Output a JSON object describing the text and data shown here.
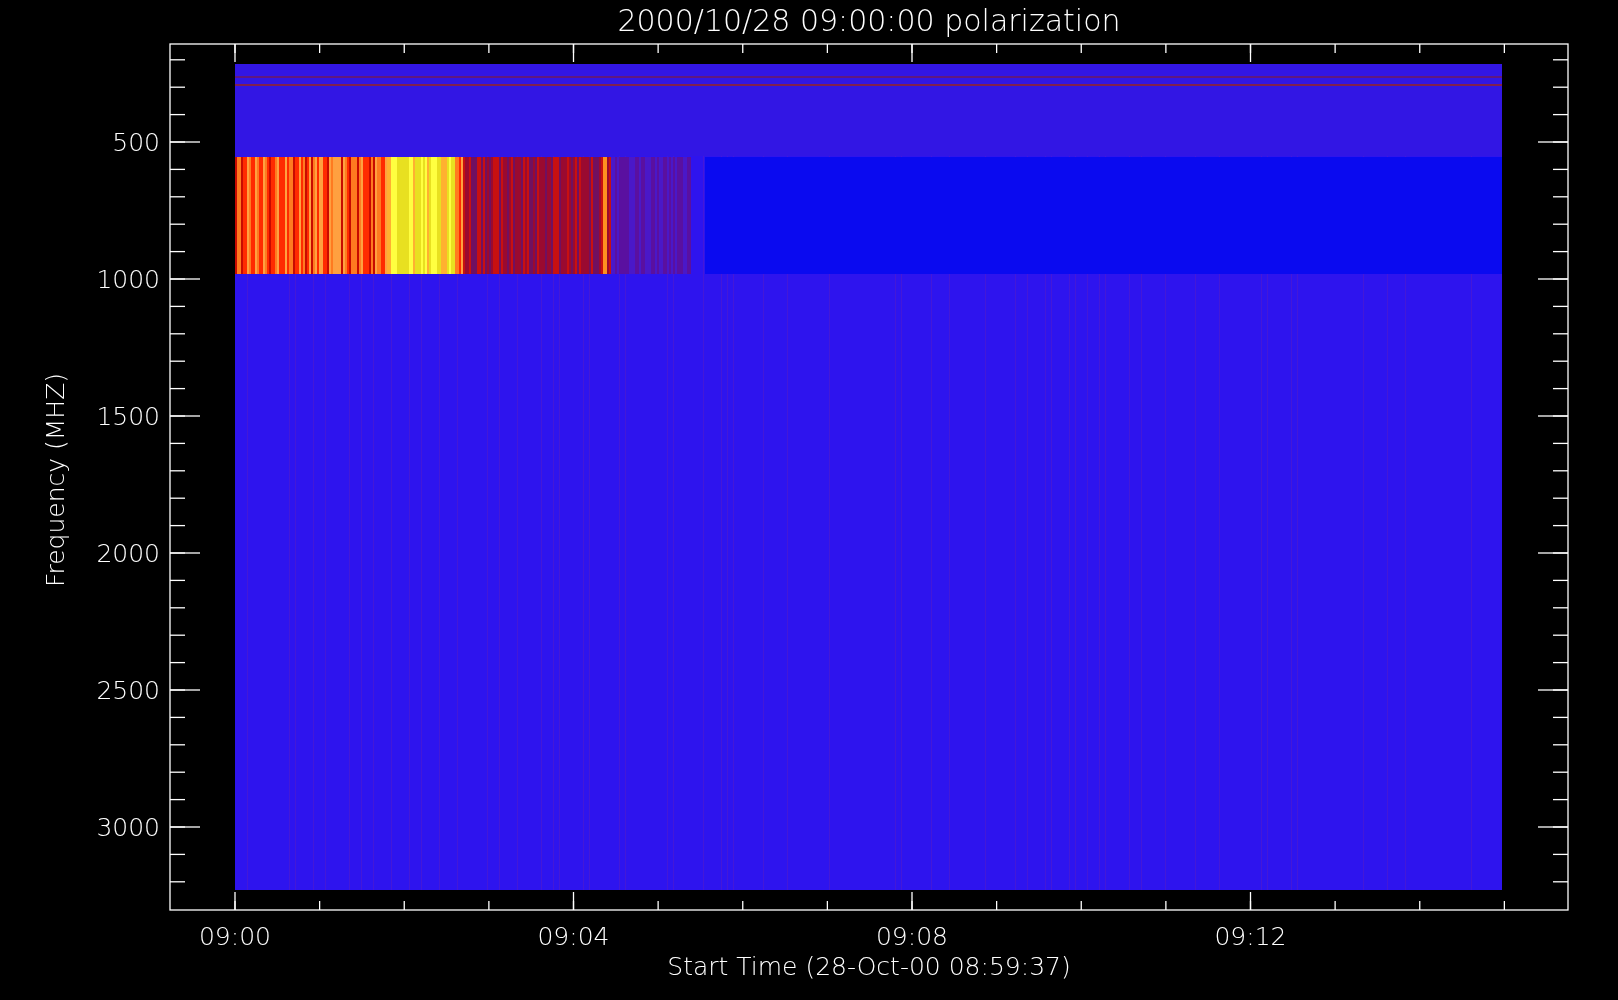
{
  "title": "2000/10/28 09:00:00 polarization",
  "y_axis": {
    "label": "Frequency (MHZ)",
    "ticks": [
      "500",
      "1000",
      "1500",
      "2000",
      "2500",
      "3000"
    ]
  },
  "x_axis": {
    "label": "Start Time (28-Oct-00 08:59:37)",
    "ticks": [
      "09:00",
      "09:04",
      "09:08",
      "09:12"
    ]
  }
}
